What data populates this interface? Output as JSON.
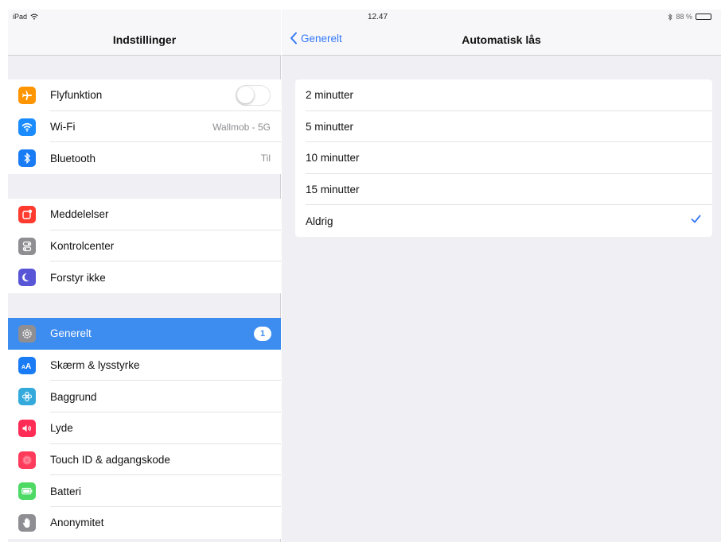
{
  "status": {
    "device": "iPad",
    "time": "12.47",
    "battery": "88 %",
    "battery_level": 0.88
  },
  "sidebar": {
    "title": "Indstillinger",
    "groups": [
      [
        {
          "label": "Flyfunktion",
          "icon": "airplane-icon",
          "color": "#ff9500",
          "accessory": "toggle",
          "on": false
        },
        {
          "label": "Wi-Fi",
          "icon": "wifi-icon",
          "color": "#1a8cff",
          "value": "Wallmob - 5G"
        },
        {
          "label": "Bluetooth",
          "icon": "bluetooth-icon",
          "color": "#1a7cf5",
          "value": "Til"
        }
      ],
      [
        {
          "label": "Meddelelser",
          "icon": "notifications-icon",
          "color": "#ff3b30"
        },
        {
          "label": "Kontrolcenter",
          "icon": "control-center-icon",
          "color": "#8e8e93"
        },
        {
          "label": "Forstyr ikke",
          "icon": "moon-icon",
          "color": "#5856d6"
        }
      ],
      [
        {
          "label": "Generelt",
          "icon": "gear-icon",
          "color": "#8e8e93",
          "selected": true,
          "badge": "1"
        },
        {
          "label": "Skærm & lysstyrke",
          "icon": "display-brightness-icon",
          "color": "#1a7cf5"
        },
        {
          "label": "Baggrund",
          "icon": "wallpaper-icon",
          "color": "#34aadc"
        },
        {
          "label": "Lyde",
          "icon": "speaker-icon",
          "color": "#ff2d55"
        },
        {
          "label": "Touch ID & adgangskode",
          "icon": "fingerprint-icon",
          "color": "#ff3b5c"
        },
        {
          "label": "Batteri",
          "icon": "battery-icon",
          "color": "#4cd964"
        },
        {
          "label": "Anonymitet",
          "icon": "hand-icon",
          "color": "#8e8e93"
        }
      ]
    ]
  },
  "detail": {
    "back_label": "Generelt",
    "title": "Automatisk lås",
    "options": [
      {
        "label": "2 minutter",
        "checked": false
      },
      {
        "label": "5 minutter",
        "checked": false
      },
      {
        "label": "10 minutter",
        "checked": false
      },
      {
        "label": "15 minutter",
        "checked": false
      },
      {
        "label": "Aldrig",
        "checked": true
      }
    ]
  },
  "colors": {
    "accent": "#3478f6",
    "selected_row": "#3d8cf0",
    "background": "#efeff4"
  }
}
